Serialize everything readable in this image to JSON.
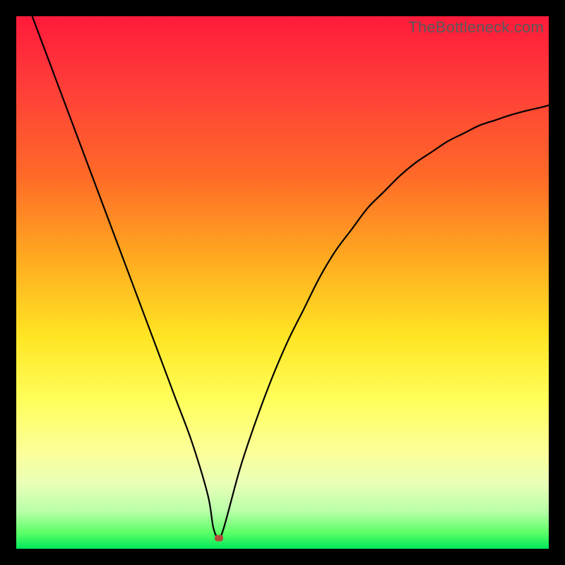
{
  "watermark": "TheBottleneck.com",
  "colors": {
    "curve": "#000000",
    "marker": "#b24a3a",
    "frame": "#000000",
    "gradient_top": "#ff1a3a",
    "gradient_bottom": "#00e85c"
  },
  "chart_data": {
    "type": "line",
    "title": "",
    "xlabel": "",
    "ylabel": "",
    "xlim": [
      0,
      100
    ],
    "ylim": [
      0,
      100
    ],
    "marker": {
      "x": 38,
      "y": 2
    },
    "series": [
      {
        "name": "bottleneck-curve",
        "x": [
          3,
          6,
          9,
          12,
          15,
          18,
          21,
          24,
          27,
          30,
          33,
          36,
          37,
          38,
          39,
          42,
          45,
          48,
          51,
          54,
          57,
          60,
          63,
          66,
          69,
          72,
          75,
          78,
          81,
          84,
          87,
          90,
          93,
          96,
          99,
          100
        ],
        "values": [
          100,
          92,
          84,
          76,
          68,
          60,
          52,
          44,
          36,
          28,
          20,
          10,
          4,
          2,
          4,
          15,
          24,
          32,
          39,
          45,
          51,
          56,
          60,
          64,
          67,
          70,
          72.5,
          74.5,
          76.5,
          78,
          79.5,
          80.5,
          81.5,
          82.3,
          83,
          83.3
        ]
      }
    ]
  }
}
